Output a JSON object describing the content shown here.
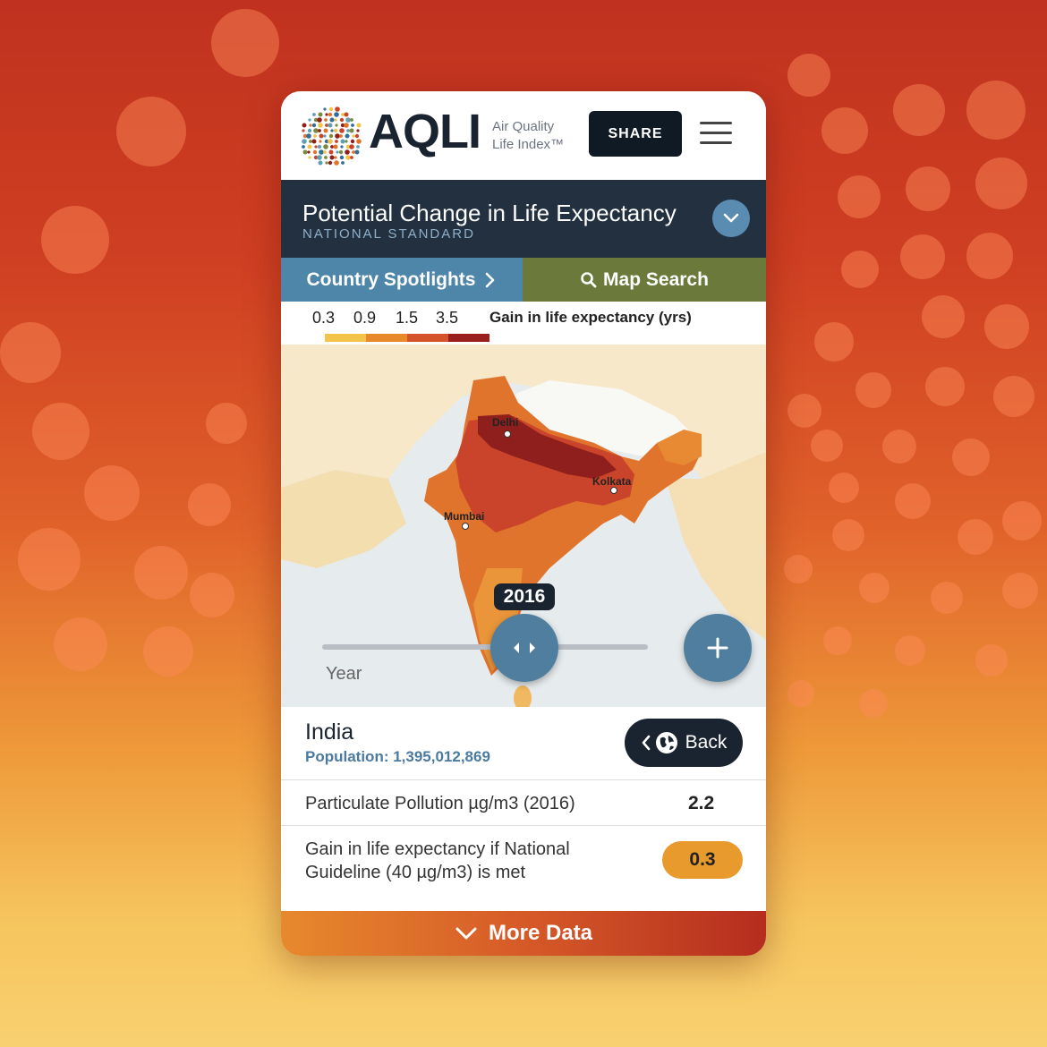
{
  "header": {
    "logo_text": "AQLI",
    "logo_sub_1": "Air Quality",
    "logo_sub_2": "Life Index™",
    "share_label": "SHARE",
    "menu_icon": "hamburger-icon"
  },
  "band": {
    "title": "Potential Change in Life Expectancy",
    "subtitle": "NATIONAL STANDARD",
    "toggle_icon": "chevron-down-icon"
  },
  "tabs": {
    "spotlights": "Country Spotlights",
    "search": "Map Search"
  },
  "legend": {
    "values": [
      "0.3",
      "0.9",
      "1.5",
      "3.5"
    ],
    "label": "Gain in life expectancy (yrs)",
    "colors": [
      "#f3c34a",
      "#e8892c",
      "#d4532a",
      "#9a1f1c"
    ]
  },
  "map": {
    "cities": [
      "Delhi",
      "Kolkata",
      "Mumbai"
    ],
    "year": "2016",
    "year_label": "Year",
    "year_progress": 0.62,
    "zoom_icon": "plus-icon"
  },
  "info": {
    "country": "India",
    "population": "Population: 1,395,012,869",
    "back_label": "Back",
    "rows": [
      {
        "label": "Particulate Pollution µg/m3 (2016)",
        "value": "2.2"
      },
      {
        "label_a": "Gain in life expectancy if National",
        "label_b": "Guideline (40 µg/m3) is met",
        "value": "0.3"
      }
    ]
  },
  "footer": {
    "more_label": "More Data"
  },
  "colors": {
    "accent_blue": "#4f7e9e",
    "dark_navy": "#1a2330",
    "olive": "#6b7a3a"
  }
}
